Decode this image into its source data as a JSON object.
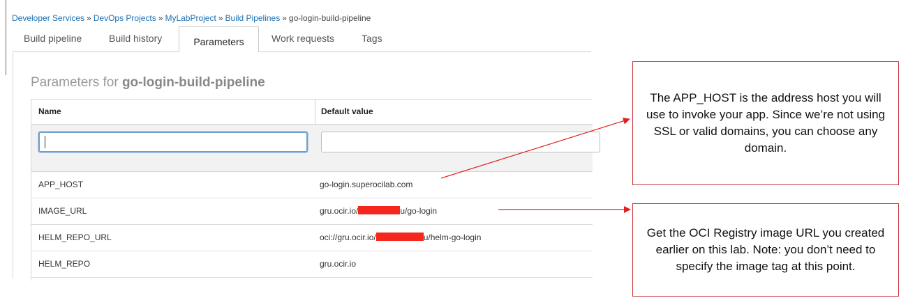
{
  "breadcrumb": {
    "items": [
      {
        "label": "Developer Services"
      },
      {
        "label": "DevOps Projects"
      },
      {
        "label": "MyLabProject"
      },
      {
        "label": "Build Pipelines"
      },
      {
        "label": "go-login-build-pipeline"
      }
    ],
    "separator": "»"
  },
  "tabs": [
    {
      "label": "Build pipeline",
      "active": false
    },
    {
      "label": "Build history",
      "active": false
    },
    {
      "label": "Parameters",
      "active": true
    },
    {
      "label": "Work requests",
      "active": false
    },
    {
      "label": "Tags",
      "active": false
    }
  ],
  "section": {
    "title_prefix": "Parameters for",
    "pipeline_name": "go-login-build-pipeline"
  },
  "table": {
    "columns": [
      "Name",
      "Default value"
    ],
    "filter": {
      "name_value": "",
      "value_value": ""
    },
    "rows": [
      {
        "name": "APP_HOST",
        "value": "go-login.superocilab.com"
      },
      {
        "name": "IMAGE_URL",
        "value_prefix": "gru.ocir.io/",
        "value_suffix": "u/go-login",
        "redacted": true
      },
      {
        "name": "HELM_REPO_URL",
        "value_prefix": "oci://gru.ocir.io/",
        "value_suffix": "u/helm-go-login",
        "redacted": true
      },
      {
        "name": "HELM_REPO",
        "value": "gru.ocir.io"
      }
    ]
  },
  "callouts": [
    {
      "text": "The APP_HOST is the address host you will use to invoke your app. Since we’re not using SSL or valid domains, you can choose any domain."
    },
    {
      "text": "Get the OCI Registry image URL you created earlier on this lab. Note: you don’t need to specify the image tag at this point."
    }
  ],
  "colors": {
    "link": "#1a6fb3",
    "callout_border": "#c8323a",
    "arrow": "#e02020",
    "redaction": "#f5261c",
    "focus_border": "#6e9fd0"
  }
}
